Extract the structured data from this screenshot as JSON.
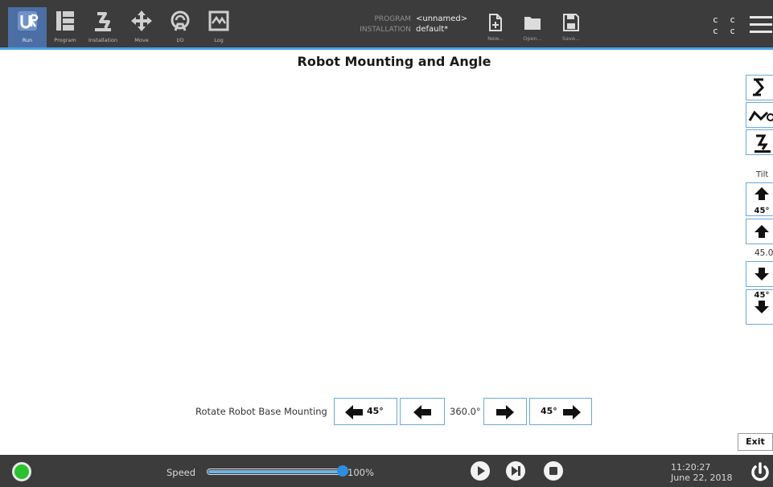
{
  "topbar": {
    "tabs": [
      {
        "label": "Run",
        "icon": "ur-logo-icon"
      },
      {
        "label": "Program",
        "icon": "program-icon"
      },
      {
        "label": "Installation",
        "icon": "installation-icon"
      },
      {
        "label": "Move",
        "icon": "move-icon"
      },
      {
        "label": "I/O",
        "icon": "io-icon"
      },
      {
        "label": "Log",
        "icon": "log-icon"
      }
    ],
    "active_tab": "Run",
    "program_label": "PROGRAM",
    "program_value": "<unnamed>",
    "installation_label": "INSTALLATION",
    "installation_value": "default*",
    "file_buttons": [
      {
        "label": "New...",
        "icon": "new-file-icon"
      },
      {
        "label": "Open...",
        "icon": "folder-icon"
      },
      {
        "label": "Save...",
        "icon": "save-icon"
      }
    ],
    "cc_row1": "c c",
    "cc_row2": "c c",
    "accent_color": "#4aa3df"
  },
  "main": {
    "title": "Robot Mounting and Angle",
    "tilt_label": "Tilt",
    "tilt_up_45_label": "45°",
    "tilt_value": "45.0",
    "tilt_down_45_label": "45°",
    "rotate_label": "Rotate Robot Base Mounting",
    "rotate_left_45_label": "45°",
    "rotate_value": "360.0°",
    "rotate_right_45_label": "45°",
    "exit_label": "Exit"
  },
  "footer": {
    "speed_label": "Speed",
    "speed_value": "100%",
    "speed_fraction": 1.0,
    "time": "11:20:27",
    "date": "June 22, 2018",
    "status_color": "#29c22f"
  }
}
